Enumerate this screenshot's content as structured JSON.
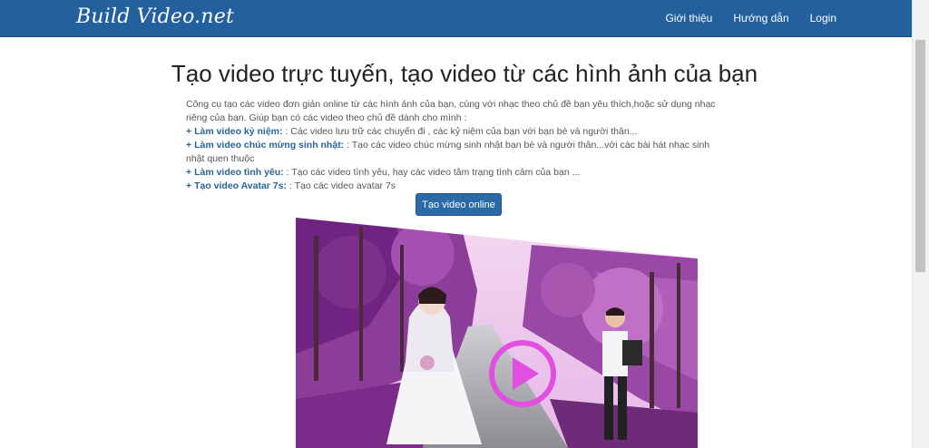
{
  "header": {
    "brand": "Build Video.net",
    "nav": [
      {
        "label": "Giới thiệu"
      },
      {
        "label": "Hướng dẫn"
      },
      {
        "label": "Login"
      }
    ]
  },
  "main": {
    "title": "Tạo video trực tuyến, tạo video từ các hình ảnh của bạn",
    "intro": "Công cụ tạo các video đơn giản online từ các hình ảnh của bạn, cùng với nhạc theo chủ đề bạn yêu thích,hoặc sử dụng nhạc riêng của bạn. Giúp bạn có các video theo chủ đề dành cho mình :",
    "features": [
      {
        "title": "Làm video kỷ niệm:",
        "desc": ": Các video lưu trữ các chuyến đi , các kỷ niệm của bạn với bạn bè và người thân..."
      },
      {
        "title": "Làm video chúc mừng sinh nhật:",
        "desc": ": Tạo các video chúc mừng sinh nhật bạn bè và người thân...với các bài hát nhạc sinh nhật quen thuộc"
      },
      {
        "title": "Làm video tình yêu:",
        "desc": ": Tạo các video tình yêu, hay các video tâm trạng tình cảm của bạn ..."
      },
      {
        "title": "Tạo video Avatar 7s:",
        "desc": ": Tạo các video avatar 7s"
      }
    ],
    "cta_label": "Tạo video online"
  },
  "colors": {
    "navbar": "#23609e",
    "link": "#2a6496",
    "button": "#2a6aa8",
    "play_icon": "#e04fe0"
  }
}
